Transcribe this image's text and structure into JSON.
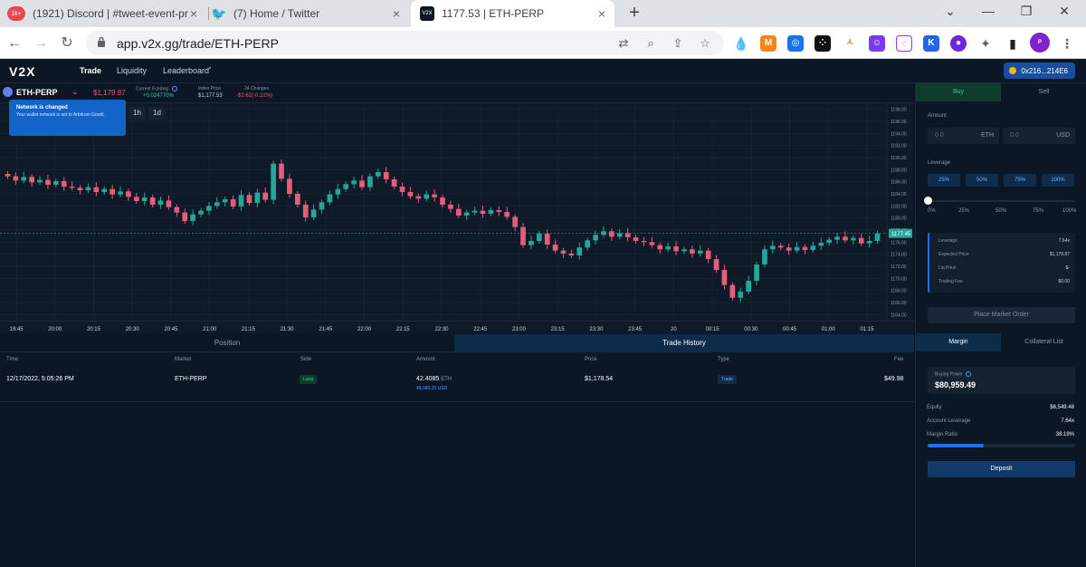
{
  "browser": {
    "tabs": [
      {
        "title": "(1921) Discord | #tweet-event-pr",
        "badge": "1k+"
      },
      {
        "title": "(7) Home / Twitter"
      },
      {
        "title": "1177.53 | ETH-PERP"
      }
    ],
    "url": "app.v2x.gg/trade/ETH-PERP"
  },
  "header": {
    "logo": "V2X",
    "nav": [
      "Trade",
      "Liquidity",
      "Leaderboard"
    ],
    "wallet": "0x216...214E6"
  },
  "market": {
    "pair": "ETH-PERP",
    "last_price": "$1,179.87",
    "funding_label": "Current Funding",
    "funding_value": "+0.024770%",
    "index_label": "Index Price",
    "index_value": "$1,177.53",
    "change_label": "24 Changes",
    "change_value": "-$2.62(-0.22%)"
  },
  "toast": {
    "title": "Network is changed",
    "body": "Your wallet network is set to Arbitrum Goerli."
  },
  "timeframes": [
    "1h",
    "1d"
  ],
  "chart_data": {
    "type": "candlestick",
    "current_price_label": "1177.45",
    "y_ticks": [
      1198.0,
      1196.0,
      1194.0,
      1192.0,
      1190.0,
      1188.0,
      1186.0,
      1184.0,
      1182.0,
      1180.0,
      1178.0,
      1176.0,
      1174.0,
      1172.0,
      1170.0,
      1168.0,
      1166.0,
      1164.0
    ],
    "ylim": [
      1163,
      1199
    ],
    "x_ticks": [
      "19:45",
      "20:00",
      "20:15",
      "20:30",
      "20:45",
      "21:00",
      "21:15",
      "21:30",
      "21:45",
      "22:00",
      "22:15",
      "22:30",
      "22:45",
      "23:00",
      "23:15",
      "23:30",
      "23:45",
      "20",
      "00:15",
      "00:30",
      "00:45",
      "01:00",
      "01:15"
    ],
    "close_values": [
      1186.9,
      1186.2,
      1186.8,
      1185.9,
      1186.3,
      1185.5,
      1186.1,
      1185.2,
      1185.0,
      1184.6,
      1185.1,
      1184.3,
      1184.8,
      1183.9,
      1184.4,
      1183.5,
      1182.8,
      1183.4,
      1182.2,
      1182.9,
      1181.8,
      1180.9,
      1179.5,
      1180.6,
      1181.2,
      1182.0,
      1182.6,
      1183.1,
      1181.9,
      1183.8,
      1182.5,
      1184.2,
      1183.0,
      1189.0,
      1186.5,
      1184.0,
      1182.2,
      1180.1,
      1181.4,
      1182.6,
      1183.9,
      1184.8,
      1185.6,
      1186.2,
      1185.1,
      1186.9,
      1187.6,
      1186.4,
      1185.2,
      1184.3,
      1183.6,
      1183.2,
      1183.9,
      1183.4,
      1182.2,
      1181.5,
      1180.4,
      1180.9,
      1181.2,
      1180.7,
      1181.3,
      1181.0,
      1180.2,
      1178.5,
      1175.5,
      1176.2,
      1177.4,
      1175.6,
      1174.6,
      1174.1,
      1173.8,
      1175.1,
      1176.3,
      1177.2,
      1177.8,
      1176.9,
      1177.5,
      1176.8,
      1176.2,
      1176.0,
      1175.5,
      1174.8,
      1175.3,
      1174.5,
      1174.8,
      1174.1,
      1174.6,
      1173.2,
      1171.4,
      1168.9,
      1166.8,
      1167.8,
      1169.6,
      1172.3,
      1174.8,
      1175.4,
      1175.1,
      1174.6,
      1175.2,
      1174.7,
      1175.4,
      1175.9,
      1176.4,
      1176.9,
      1176.3,
      1176.7,
      1175.8,
      1176.2,
      1177.45
    ]
  },
  "bottom": {
    "tabs": [
      "Position",
      "Trade History"
    ],
    "columns": [
      "Time",
      "Market",
      "Side",
      "Amount",
      "Price",
      "Type",
      "Fee"
    ],
    "rows": [
      {
        "time": "12/17/2022, 5:05:26 PM",
        "market": "ETH-PERP",
        "side": "Long",
        "amount": "42.4085",
        "amount_unit": "ETH",
        "amount_usd": "49,980.25 USD",
        "price": "$1,178.54",
        "type": "Trade",
        "fee": "$49.98"
      }
    ]
  },
  "order": {
    "buy": "Buy",
    "sell": "Sell",
    "amount_label": "Amount",
    "amount_eth": "0.0",
    "unit_eth": "ETH",
    "amount_usd": "0.0",
    "unit_usd": "USD",
    "leverage_label": "Leverage",
    "leverage_buttons": [
      "25%",
      "50%",
      "75%",
      "100%"
    ],
    "slider_labels": [
      "0%",
      "25%",
      "50%",
      "75%",
      "100%"
    ],
    "slider_level": 0,
    "summary": [
      {
        "label": "Leverage",
        "value": "7.64x"
      },
      {
        "label": "Expected Price",
        "value": "$1,179.87"
      },
      {
        "label": "Liq Price",
        "value": "$-"
      },
      {
        "label": "Trading Fee",
        "value": "$0.00"
      }
    ],
    "submit": "Place Market Order"
  },
  "margin": {
    "tabs": [
      "Margin",
      "Collateral List"
    ],
    "buying_power_label": "Buying Power",
    "buying_power": "$80,959.49",
    "rows": [
      {
        "label": "Equity",
        "value": "$6,549.48"
      },
      {
        "label": "Account Leverage",
        "value": "7.64x"
      },
      {
        "label": "Margin Ratio",
        "value": "38.19%"
      }
    ],
    "margin_ratio": 0.3819,
    "deposit": "Deposit"
  },
  "colors": {
    "up": "#26a69a",
    "down": "#e55c7c",
    "accent": "#1a73e8"
  }
}
